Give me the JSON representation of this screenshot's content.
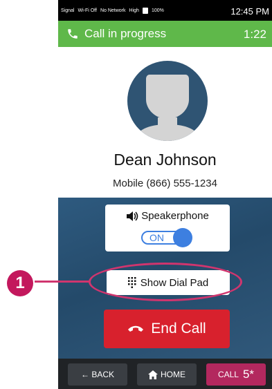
{
  "status_bar": {
    "signal": "Signal",
    "wifi": "Wi-Fi Off",
    "network": "No Network",
    "bluetooth": "High",
    "battery": "100%",
    "time": "12:45 PM"
  },
  "call_header": {
    "title": "Call in progress",
    "timer": "1:22"
  },
  "contact": {
    "name": "Dean Johnson",
    "number": "Mobile (866) 555-1234"
  },
  "controls": {
    "speaker_label": "Speakerphone",
    "speaker_state": "ON",
    "dialpad_label": "Show Dial Pad",
    "end_call_label": "End Call"
  },
  "nav": {
    "back": "← BACK",
    "home": "HOME",
    "call": "CALL",
    "call_count": "5*"
  },
  "annotation": {
    "number": "1"
  },
  "colors": {
    "header_green": "#5fb84a",
    "panel_blue": "#2e5a7f",
    "end_call_red": "#d8212d",
    "toggle_blue": "#3d7fe0",
    "annotation_pink": "#c3185d",
    "call_btn_magenta": "#b3285e"
  }
}
